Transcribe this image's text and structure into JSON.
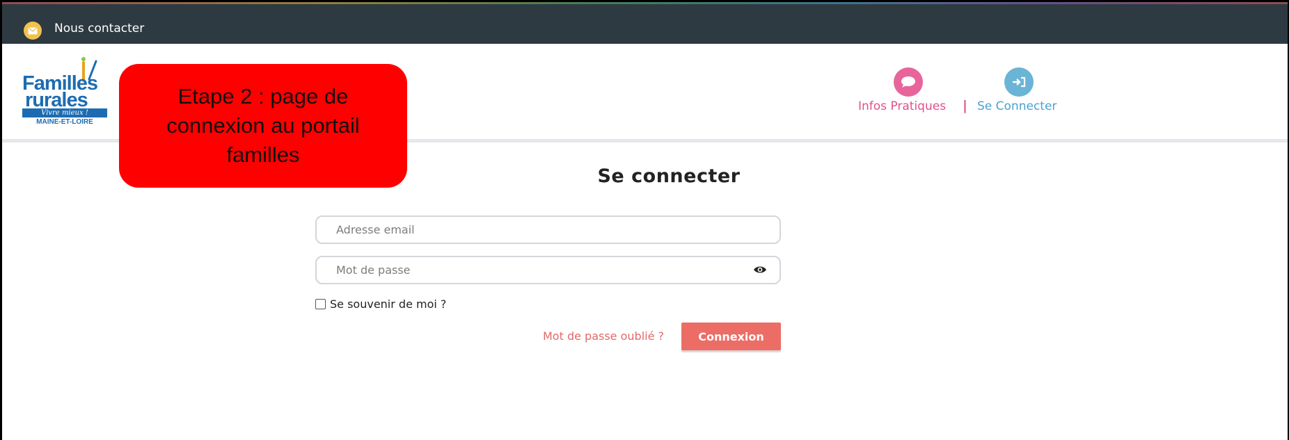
{
  "topbar": {
    "contact_label": "Nous contacter",
    "contact_icon": "envelope-icon"
  },
  "logo": {
    "line1": "Familles",
    "line2": "rurales",
    "tagline": "Vivre mieux !",
    "region": "MAINE-ET-LOIRE"
  },
  "callout": {
    "text": "Etape 2 : page de connexion au portail familles"
  },
  "nav": {
    "infos_label": "Infos Pratiques",
    "infos_icon": "chat-bubble-icon",
    "separator": "|",
    "connect_label": "Se Connecter",
    "connect_icon": "sign-in-icon"
  },
  "form": {
    "title": "Se connecter",
    "email_placeholder": "Adresse email",
    "password_placeholder": "Mot de passe",
    "remember_label": "Se souvenir de moi ?",
    "remember_checked": false,
    "forgot_label": "Mot de passe oublié ?",
    "submit_label": "Connexion"
  },
  "colors": {
    "topbar_bg": "#2e3a42",
    "brand_blue": "#1d6cb1",
    "infos_pink": "#e0508c",
    "connect_blue": "#4ba1cc",
    "button_red": "#ec6d65",
    "callout_red": "#ff0000"
  }
}
